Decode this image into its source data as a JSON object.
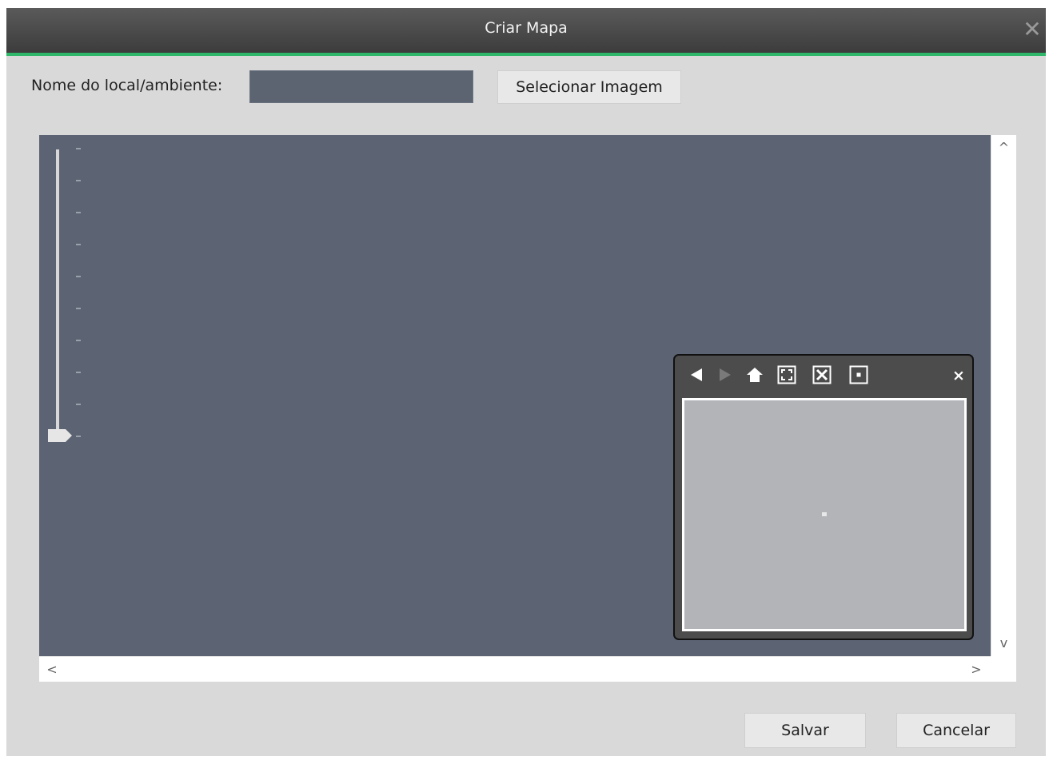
{
  "dialog": {
    "title": "Criar Mapa",
    "close_symbol": "✕"
  },
  "form": {
    "name_label": "Nome do local/ambiente:",
    "name_value": "",
    "select_image_label": "Selecionar Imagem"
  },
  "map": {
    "zoom_ticks": 10,
    "zoom_level": 0
  },
  "overview": {
    "icons": [
      "back-arrow-icon",
      "forward-arrow-icon",
      "home-icon",
      "fit-screen-icon",
      "full-extent-icon",
      "actual-size-icon"
    ],
    "close_symbol": "×"
  },
  "scrollbars": {
    "up": "^",
    "down": "v",
    "left": "<",
    "right": ">"
  },
  "footer": {
    "save_label": "Salvar",
    "cancel_label": "Cancelar"
  },
  "colors": {
    "accent": "#2fb86a",
    "map_background": "#5c6473",
    "titlebar": "#4a4a4a"
  }
}
